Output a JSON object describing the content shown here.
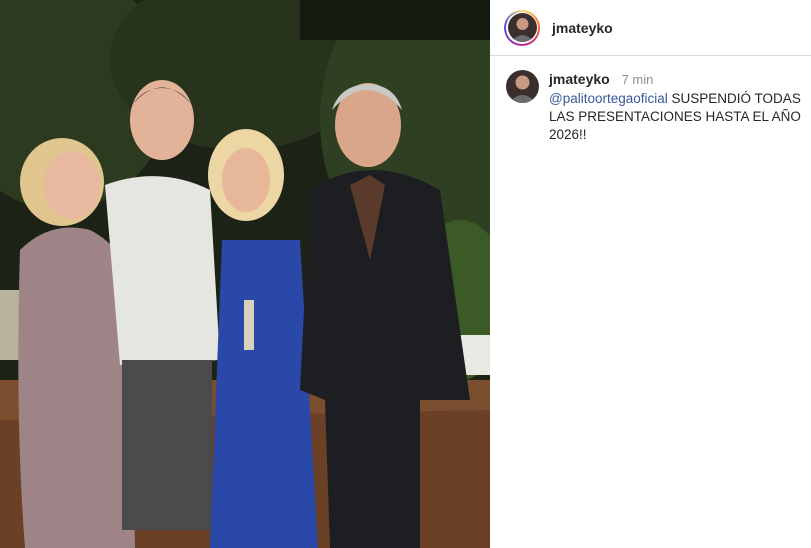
{
  "post": {
    "author": "jmateyko",
    "comment": {
      "author": "jmateyko",
      "time": "7 min",
      "mention": "@palitoortegaoficial",
      "text": " SUSPENDIÓ TODAS LAS PRESENTACIONES HASTA EL AÑO 2026!!"
    }
  },
  "colors": {
    "mention": "#385898",
    "username": "#262626",
    "timestamp": "#8e8e8e",
    "divider": "#dbdbdb"
  },
  "icons": [
    "profile-avatar",
    "comment-avatar"
  ]
}
